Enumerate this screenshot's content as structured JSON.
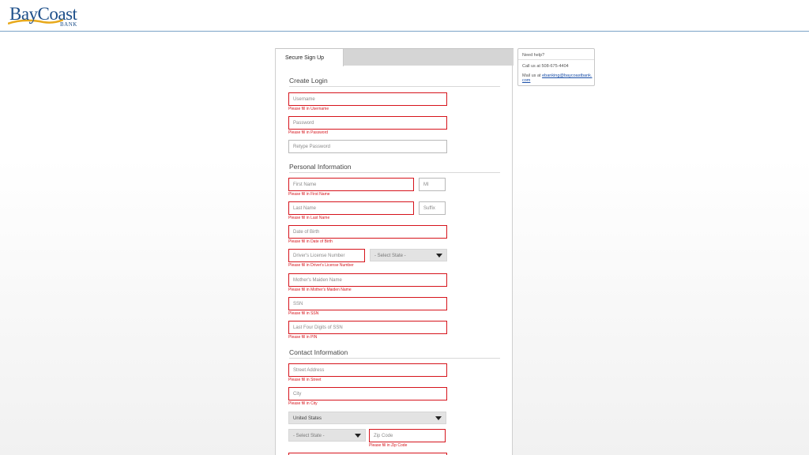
{
  "brand": {
    "name": "BayCoast",
    "sub": "BANK"
  },
  "tab": {
    "label": "Secure Sign Up"
  },
  "sections": {
    "login": "Create Login",
    "personal": "Personal Information",
    "contact": "Contact Information"
  },
  "fields": {
    "username": {
      "placeholder": "Username",
      "error": "Please fill in Username"
    },
    "password": {
      "placeholder": "Password",
      "error": "Please fill in Password"
    },
    "retype": {
      "placeholder": "Retype Password"
    },
    "first_name": {
      "placeholder": "First Name",
      "error": "Please fill in First Name"
    },
    "mi": {
      "placeholder": "MI"
    },
    "last_name": {
      "placeholder": "Last Name",
      "error": "Please fill in Last Name"
    },
    "suffix": {
      "placeholder": "Suffix"
    },
    "dob": {
      "placeholder": "Date of Birth",
      "error": "Please fill in Date of Birth"
    },
    "license": {
      "placeholder": "Driver's License Number",
      "error": "Please fill in Driver's License Number"
    },
    "license_state": {
      "value": "- Select State -"
    },
    "maiden": {
      "placeholder": "Mother's Maiden Name",
      "error": "Please fill in Mother's Maiden Name"
    },
    "ssn": {
      "placeholder": "SSN",
      "error": "Please fill in SSN"
    },
    "last4": {
      "placeholder": "Last Four Digits of SSN",
      "error": "Please fill in PIN"
    },
    "street": {
      "placeholder": "Street Address",
      "error": "Please fill in Street"
    },
    "city": {
      "placeholder": "City",
      "error": "Please fill in City"
    },
    "country": {
      "value": "United States"
    },
    "state": {
      "value": "- Select State -"
    },
    "zip": {
      "placeholder": "Zip Code",
      "error": "Please fill in Zip Code"
    }
  },
  "help": {
    "title": "Need help?",
    "call": "Call us at 508-675-4404",
    "mail_prefix": "Mail us at ",
    "mail_link": "ebanking@baycoastbank.com"
  },
  "colors": {
    "error": "#d6141c",
    "brand": "#1d4f8a",
    "link": "#1a4fa8"
  }
}
